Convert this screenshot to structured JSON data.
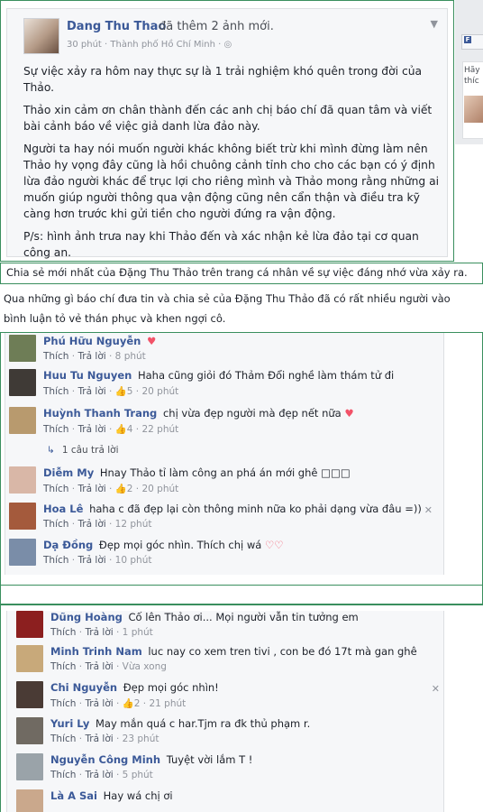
{
  "post": {
    "author": "Dang Thu Thao",
    "action": "đã thêm 2 ảnh mới.",
    "meta": "30 phút · Thành phố Hồ Chí Minh · ◎",
    "paragraphs": [
      "Sự việc xảy ra hôm nay thực sự là 1 trải nghiệm khó quên trong đời của Thảo.",
      "Thảo xin cảm ơn chân thành đến các anh chị báo chí đã quan tâm và viết bài cảnh báo về việc giả danh lừa đảo này.",
      "Người ta hay nói muốn người khác không biết trừ khi mình đừng làm nên Thảo hy vọng đây cũng là hồi chuông cảnh tỉnh cho cho các bạn có ý định lừa đảo người khác để trục lợi cho riêng mình và Thảo mong rằng những ai muốn giúp người thông qua vận động cũng nên cẩn thận và điều tra kỹ càng hơn trước khi gửi tiền cho người đứng ra vận động.",
      "P/s: hình ảnh trưa nay khi Thảo đến và xác nhận kẻ lừa đảo tại cơ quan công an."
    ]
  },
  "sidebar_sliver": {
    "button_label": "F",
    "text": "Hãy thíc"
  },
  "captions": {
    "caption_1": "Chia sẻ mới nhất của Đặng Thu Thảo trên trang cá nhân về sự việc đáng nhớ vừa xảy ra.",
    "caption_2": "Qua những gì báo chí đưa tin và chia sẻ của Đặng Thu Thảo đã có rất nhiều người vào bình luận tỏ vẻ thán phục và khen ngợi cô."
  },
  "comments_1": [
    {
      "author": "Phú Hữu Nguyễn",
      "text": "",
      "heart": "♥",
      "like": "Thích",
      "reply": "Trả lời",
      "likes": "",
      "time": "8 phút",
      "avatar_color": "#6e7d56"
    },
    {
      "author": "Huu Tu Nguyen",
      "text": "Haha cũng giỏi đó Thảm Đổi nghề làm thám tử đi",
      "heart": "",
      "like": "Thích",
      "reply": "Trả lời",
      "likes": "5",
      "time": "20 phút",
      "avatar_color": "#3f3a36"
    },
    {
      "author": "Huỳnh Thanh Trang",
      "text": "chị vừa đẹp người mà đẹp nết nữa",
      "heart": "♥",
      "like": "Thích",
      "reply": "Trả lời",
      "likes": "4",
      "time": "22 phút",
      "avatar_color": "#b89a6e"
    },
    {
      "author": "Diễm My",
      "text": "Hnay Thảo tỉ làm công an phá án mới ghê □□□",
      "heart": "",
      "like": "Thích",
      "reply": "Trả lời",
      "likes": "2",
      "time": "20 phút",
      "avatar_color": "#d9b7a7"
    },
    {
      "author": "Hoa Lê",
      "text": "haha c đã đẹp lại còn thông minh nữa ko phải dạng vừa đâu =))",
      "heart": "",
      "like": "Thích",
      "reply": "Trả lời",
      "likes": "",
      "time": "12 phút",
      "avatar_color": "#a45a3c"
    },
    {
      "author": "Dạ Đồng",
      "text": "Đẹp mọi góc nhìn. Thích chị wá",
      "heart": "♡♡",
      "like": "Thích",
      "reply": "Trả lời",
      "likes": "",
      "time": "10 phút",
      "avatar_color": "#7a8da8"
    }
  ],
  "reply_link": "1 câu trả lời",
  "comments_2": [
    {
      "author": "Dũng Hoàng",
      "text": "Cố lên Thảo ơi... Mọi người vẫn tin tưởng em",
      "like": "Thích",
      "reply": "Trả lời",
      "likes": "",
      "time": "1 phút",
      "avatar_color": "#8c1f1f"
    },
    {
      "author": "Minh Trinh Nam",
      "text": "luc nay co xem tren tivi , con be đó 17t mà gan ghê",
      "like": "Thích",
      "reply": "Trả lời",
      "likes": "",
      "time": "Vừa xong",
      "avatar_color": "#c8a97a"
    },
    {
      "author": "Chi Nguyễn",
      "text": "Đẹp mọi góc nhìn!",
      "like": "Thích",
      "reply": "Trả lời",
      "likes": "2",
      "time": "21 phút",
      "avatar_color": "#4a3b35"
    },
    {
      "author": "Yuri Ly",
      "text": "May mắn quá c har.Tjm ra đk thủ phạm r.",
      "like": "Thích",
      "reply": "Trả lời",
      "likes": "",
      "time": "23 phút",
      "avatar_color": "#706a62"
    },
    {
      "author": "Nguyễn Công Minh",
      "text": "Tuyệt vời lắm T !",
      "like": "Thích",
      "reply": "Trả lời",
      "likes": "",
      "time": "5 phút",
      "avatar_color": "#9aa3a9"
    },
    {
      "author": "Là A Sai",
      "text": "Hay wá chị ơi",
      "like": "",
      "reply": "",
      "likes": "",
      "time": "",
      "avatar_color": "#caa88c"
    }
  ],
  "colors": {
    "link_blue": "#3b5998",
    "frame_green": "#3a8f5e",
    "heart_red": "#f25268"
  }
}
